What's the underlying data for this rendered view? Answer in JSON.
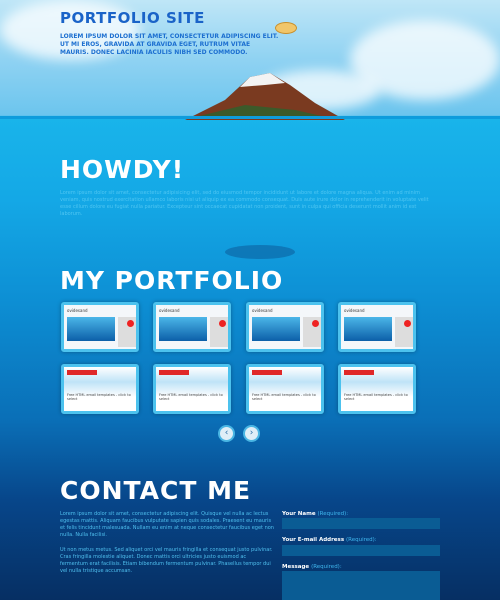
{
  "header": {
    "title": "PORTFOLIO SITE",
    "tagline": "Lorem ipsum dolor sit amet, consectetur adipiscing elit. Ut mi eros, gravida at gravida eget, rutrum vitae mauris. Donec lacinia iaculis nibh sed commodo."
  },
  "howdy": {
    "heading": "HOWDY!",
    "text": "Lorem ipsum dolor sit amet, consectetur adipisicing elit, sed do eiusmod tempor incididunt ut labore et dolore magna aliqua. Ut enim ad minim veniam, quis nostrud exercitation ullamco laboris nisi ut aliquip ex ea commodo consequat. Duis aute irure dolor in reprehenderit in voluptate velit esse cillum dolore eu fugiat nulla pariatur. Excepteur sint occaecat cupidatat non proident, sunt in culpa qui officia deserunt mollit anim id est laborum."
  },
  "portfolio": {
    "heading": "MY PORTFOLIO",
    "site_logo": "ovidesand",
    "email_caption": "Free HTML email templates - click to select",
    "prev_icon": "chevron-left-icon",
    "next_icon": "chevron-right-icon",
    "prev": "‹",
    "next": "›"
  },
  "contact": {
    "heading": "CONTACT ME",
    "p1": "Lorem ipsum dolor sit amet, consectetur adipiscing elit. Quisque vel nulla ac lectus egestas mattis. Aliquam faucibus vulputate sapien quis sodales. Praesent eu mauris et felis tincidunt malesuada. Nullam eu enim at neque consectetur faucibus eget non nulla. Nulla facilisi.",
    "p2": "Ut non metus metus. Sed aliquet orci vel mauris fringilla et consequat justo pulvinar. Cras fringilla molestie aliquet. Donec mattis orci ultricies justo euismod ac fermentum erat facilisis. Etiam bibendum fermentum pulvinar. Phasellus tempor dui vel nulla tristique accumsan.",
    "name_label": "Your Name",
    "email_label": "Your E-mail Address",
    "message_label": "Message",
    "required": "(Required):"
  }
}
